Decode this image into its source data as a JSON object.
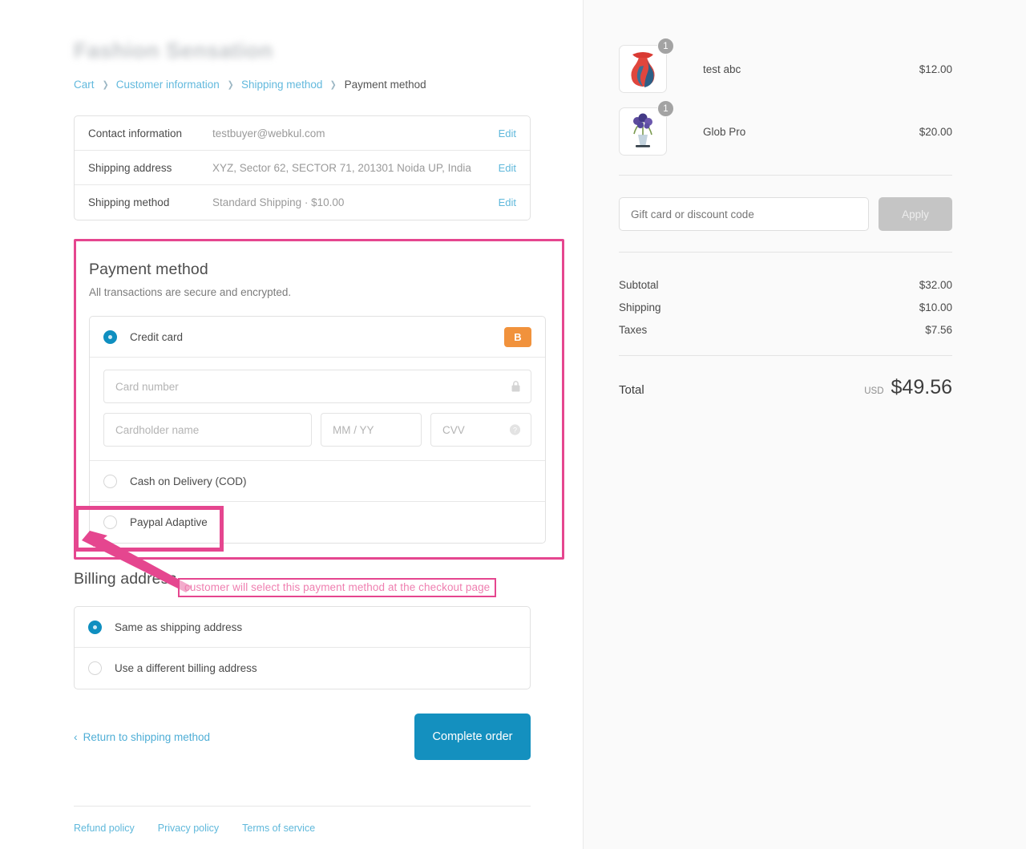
{
  "store": {
    "name": "Fashion Sensation"
  },
  "breadcrumb": {
    "items": [
      {
        "label": "Cart",
        "current": false
      },
      {
        "label": "Customer information",
        "current": false
      },
      {
        "label": "Shipping method",
        "current": false
      },
      {
        "label": "Payment method",
        "current": true
      }
    ],
    "separator": "❯"
  },
  "review": {
    "edit_label": "Edit",
    "rows": [
      {
        "label": "Contact information",
        "value": "testbuyer@webkul.com"
      },
      {
        "label": "Shipping address",
        "value": "XYZ, Sector 62, SECTOR 71, 201301 Noida UP, India"
      },
      {
        "label": "Shipping method",
        "value": "Standard Shipping · $10.00"
      }
    ]
  },
  "payment": {
    "title": "Payment method",
    "subtitle": "All transactions are secure and encrypted.",
    "methods": [
      {
        "label": "Credit card",
        "selected": true,
        "badge": "B"
      },
      {
        "label": "Cash on Delivery (COD)",
        "selected": false,
        "badge": ""
      },
      {
        "label": "Paypal Adaptive",
        "selected": false,
        "badge": ""
      }
    ],
    "card_fields": {
      "number_placeholder": "Card number",
      "name_placeholder": "Cardholder name",
      "expiry_placeholder": "MM / YY",
      "cvv_placeholder": "CVV"
    }
  },
  "annotation": {
    "text": "customer will select this payment method at the checkout page",
    "color": "#e5468f"
  },
  "billing": {
    "title": "Billing address",
    "options": [
      {
        "label": "Same as shipping address",
        "selected": true
      },
      {
        "label": "Use a different billing address",
        "selected": false
      }
    ]
  },
  "actions": {
    "return_label": "Return to shipping method",
    "complete_label": "Complete order"
  },
  "footer": {
    "links": [
      "Refund policy",
      "Privacy policy",
      "Terms of service"
    ]
  },
  "summary": {
    "items": [
      {
        "name": "test abc",
        "price": "$12.00",
        "qty": "1"
      },
      {
        "name": "Glob Pro",
        "price": "$20.00",
        "qty": "1"
      }
    ],
    "discount": {
      "placeholder": "Gift card or discount code",
      "apply_label": "Apply"
    },
    "totals": [
      {
        "label": "Subtotal",
        "amount": "$32.00"
      },
      {
        "label": "Shipping",
        "amount": "$10.00"
      },
      {
        "label": "Taxes",
        "amount": "$7.56"
      }
    ],
    "grand": {
      "label": "Total",
      "currency": "USD",
      "amount": "$49.56"
    }
  },
  "colors": {
    "accent": "#1490bf",
    "link": "#5fb8db",
    "badge": "#f1923c",
    "annotation": "#e5468f"
  }
}
